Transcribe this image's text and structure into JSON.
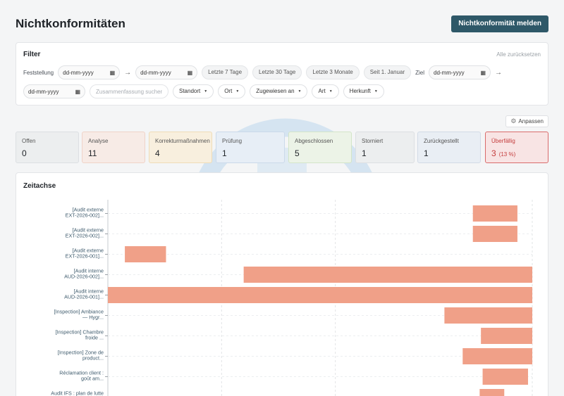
{
  "header": {
    "title": "Nichtkonformitäten",
    "report_button": "Nichtkonformität melden"
  },
  "filter": {
    "title": "Filter",
    "reset_label": "Alle zurücksetzen",
    "feststellung_label": "Feststellung",
    "date_placeholder": "dd-mm-yyyy",
    "arrow": "→",
    "calendar_glyph": "▦",
    "presets": [
      "Letzte 7 Tage",
      "Letzte 30 Tage",
      "Letzte 3 Monate",
      "Seit 1. Januar"
    ],
    "ziel_label": "Ziel",
    "search_placeholder": "Zusammenfassung suchen...",
    "dropdowns": [
      "Standort",
      "Ort",
      "Zugewiesen an",
      "Art",
      "Herkunft"
    ],
    "caret": "▼"
  },
  "adjust_button": "Anpassen",
  "status_cards": [
    {
      "label": "Offen",
      "count": "0",
      "bg": "#eceeef",
      "border": "#dcdfe2",
      "label_color": "#555",
      "count_color": "#1f2328"
    },
    {
      "label": "Analyse",
      "count": "11",
      "bg": "#f7ebe6",
      "border": "#efd3c8",
      "label_color": "#555",
      "count_color": "#1f2328"
    },
    {
      "label": "Korrekturmaßnahmen",
      "count": "4",
      "bg": "#f8efde",
      "border": "#efdcb7",
      "label_color": "#555",
      "count_color": "#1f2328"
    },
    {
      "label": "Prüfung",
      "count": "1",
      "bg": "#e7eef6",
      "border": "#cbd9ea",
      "label_color": "#555",
      "count_color": "#1f2328"
    },
    {
      "label": "Abgeschlossen",
      "count": "5",
      "bg": "#ecf3e7",
      "border": "#d3e5c8",
      "label_color": "#555",
      "count_color": "#1f2328"
    },
    {
      "label": "Storniert",
      "count": "1",
      "bg": "#eceeef",
      "border": "#dcdfe2",
      "label_color": "#555",
      "count_color": "#1f2328"
    },
    {
      "label": "Zurückgestellt",
      "count": "1",
      "bg": "#e9eef4",
      "border": "#d2dbe6",
      "label_color": "#555",
      "count_color": "#1f2328"
    },
    {
      "label": "Überfällig",
      "count": "3",
      "pct": "(13 %)",
      "bg": "#f8e4e4",
      "border": "#d96b6b",
      "label_color": "#c43d3d",
      "count_color": "#c43d3d"
    }
  ],
  "colors": {
    "accent": "#2e5868",
    "bar": "#f0a088",
    "axis_label": "#3d5a6c"
  },
  "chart_data": {
    "type": "bar",
    "title": "Zeitachse",
    "orientation": "horizontal",
    "grid": true,
    "x_range": [
      0,
      1
    ],
    "items": [
      {
        "label": [
          "[Audit externe",
          "EXT-2026-002]..."
        ],
        "start": 0.86,
        "end": 0.965
      },
      {
        "label": [
          "[Audit externe",
          "EXT-2026-002]..."
        ],
        "start": 0.86,
        "end": 0.965
      },
      {
        "label": [
          "[Audit externe",
          "EXT-2026-001]..."
        ],
        "start": 0.04,
        "end": 0.137
      },
      {
        "label": [
          "[Audit interne",
          "AUD-2026-002]..."
        ],
        "start": 0.32,
        "end": 1.0
      },
      {
        "label": [
          "[Audit interne",
          "AUD-2026-001]..."
        ],
        "start": 0.0,
        "end": 1.0
      },
      {
        "label": [
          "[Inspection] Ambiance",
          "— Hygr..."
        ],
        "start": 0.793,
        "end": 1.0
      },
      {
        "label": [
          "[Inspection] Chambre",
          "froide ..."
        ],
        "start": 0.879,
        "end": 1.0
      },
      {
        "label": [
          "[Inspection] Zone de",
          "product..."
        ],
        "start": 0.836,
        "end": 1.0
      },
      {
        "label": [
          "Réclamation client :",
          "goût am..."
        ],
        "start": 0.883,
        "end": 0.99
      },
      {
        "label": [
          "Audit IFS : plan de lutte",
          ""
        ],
        "start": 0.876,
        "end": 0.934
      }
    ]
  }
}
